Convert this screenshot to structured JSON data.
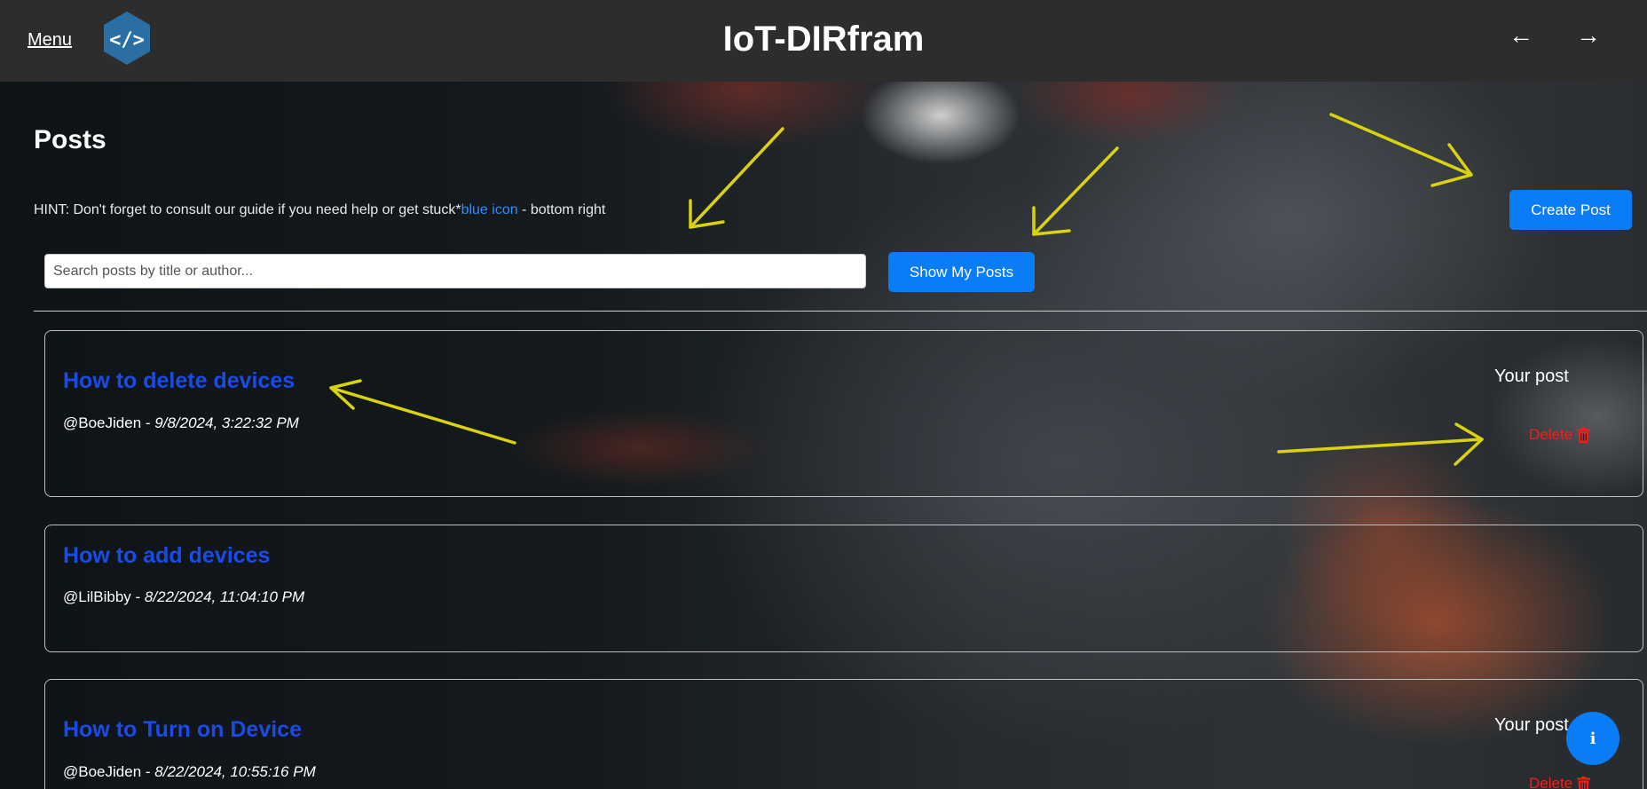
{
  "header": {
    "menu_label": "Menu",
    "logo_icon": "code-brackets-icon",
    "title": "IoT-DIRfram",
    "back_arrow": "←",
    "forward_arrow": "→"
  },
  "page": {
    "title": "Posts",
    "hint": {
      "label": "HINT",
      "text": ": Don't forget to consult our guide if you need help or get stuck*",
      "link_text": "blue icon",
      "suffix": " - bottom right"
    },
    "create_post_label": "Create Post",
    "search": {
      "placeholder": "Search posts by title or author...",
      "value": ""
    },
    "show_my_posts_label": "Show My Posts"
  },
  "posts": [
    {
      "title": "How to delete devices",
      "author": "@BoeJiden",
      "separator": " - ",
      "date": "9/8/2024, 3:22:32 PM",
      "own_label": "Your post",
      "delete_label": "Delete"
    },
    {
      "title": "How to add devices",
      "author": "@LilBibby",
      "separator": " - ",
      "date": "8/22/2024, 11:04:10 PM"
    },
    {
      "title": "How to Turn on Device",
      "author": "@BoeJiden",
      "separator": " - ",
      "date": "8/22/2024, 10:55:16 PM",
      "own_label": "Your post",
      "delete_label": "Delete"
    }
  ],
  "info_button": {
    "icon": "info-icon",
    "glyph": "i"
  },
  "colors": {
    "header_bg": "#2d2d2d",
    "accent": "#0a7cf5",
    "post_title": "#1a4be8",
    "delete": "#ff1a1a",
    "annotation_arrow": "#d8d20f"
  }
}
